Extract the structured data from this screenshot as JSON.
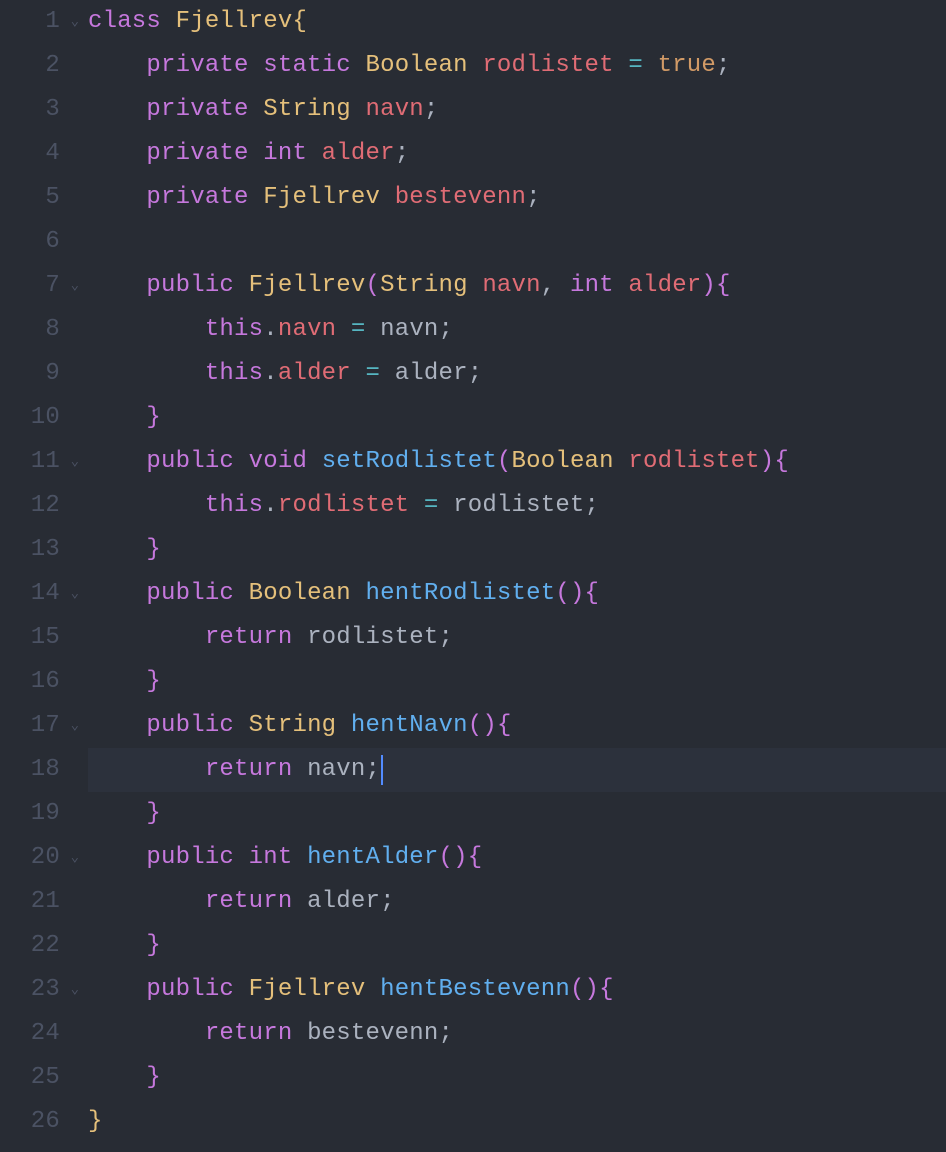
{
  "colors": {
    "background": "#282c34",
    "gutter": "#4b5263",
    "foreground": "#abb2bf",
    "keyword": "#c678dd",
    "type": "#e5c07b",
    "identifier": "#e06c75",
    "function": "#61afef",
    "literal": "#d19a66",
    "operator": "#56b6c2",
    "lineHighlight": "#2c313c",
    "cursor": "#528bff"
  },
  "activeLine": 18,
  "foldLines": [
    1,
    7,
    11,
    14,
    17,
    20,
    23
  ],
  "foldGlyph": "⌄",
  "gutter": {
    "1": "1",
    "2": "2",
    "3": "3",
    "4": "4",
    "5": "5",
    "6": "6",
    "7": "7",
    "8": "8",
    "9": "9",
    "10": "10",
    "11": "11",
    "12": "12",
    "13": "13",
    "14": "14",
    "15": "15",
    "16": "16",
    "17": "17",
    "18": "18",
    "19": "19",
    "20": "20",
    "21": "21",
    "22": "22",
    "23": "23",
    "24": "24",
    "25": "25",
    "26": "26"
  },
  "code": {
    "line1": {
      "kw_class": "class",
      "sp": " ",
      "type": "Fjellrev",
      "brace": "{"
    },
    "line2": {
      "ind": "    ",
      "kw1": "private",
      "sp1": " ",
      "kw2": "static",
      "sp2": " ",
      "type": "Boolean",
      "sp3": " ",
      "name": "rodlistet",
      "sp4": " ",
      "op": "=",
      "sp5": " ",
      "lit": "true",
      "semi": ";"
    },
    "line3": {
      "ind": "    ",
      "kw": "private",
      "sp1": " ",
      "type": "String",
      "sp2": " ",
      "name": "navn",
      "semi": ";"
    },
    "line4": {
      "ind": "    ",
      "kw": "private",
      "sp1": " ",
      "type": "int",
      "sp2": " ",
      "name": "alder",
      "semi": ";"
    },
    "line5": {
      "ind": "    ",
      "kw": "private",
      "sp1": " ",
      "type": "Fjellrev",
      "sp2": " ",
      "name": "bestevenn",
      "semi": ";"
    },
    "line7": {
      "ind": "    ",
      "kw": "public",
      "sp1": " ",
      "type": "Fjellrev",
      "lp": "(",
      "p1t": "String",
      "sp2": " ",
      "p1n": "navn",
      "comma": ",",
      "sp3": " ",
      "p2t": "int",
      "sp4": " ",
      "p2n": "alder",
      "rp": ")",
      "brace": "{"
    },
    "line8": {
      "ind": "        ",
      "this": "this",
      "dot": ".",
      "field": "navn",
      "sp1": " ",
      "op": "=",
      "sp2": " ",
      "val": "navn",
      "semi": ";"
    },
    "line9": {
      "ind": "        ",
      "this": "this",
      "dot": ".",
      "field": "alder",
      "sp1": " ",
      "op": "=",
      "sp2": " ",
      "val": "alder",
      "semi": ";"
    },
    "line10": {
      "ind": "    ",
      "brace": "}"
    },
    "line11": {
      "ind": "    ",
      "kw1": "public",
      "sp1": " ",
      "kw2": "void",
      "sp2": " ",
      "func": "setRodlistet",
      "lp": "(",
      "pt": "Boolean",
      "sp3": " ",
      "pn": "rodlistet",
      "rp": ")",
      "brace": "{"
    },
    "line12": {
      "ind": "        ",
      "this": "this",
      "dot": ".",
      "field": "rodlistet",
      "sp1": " ",
      "op": "=",
      "sp2": " ",
      "val": "rodlistet",
      "semi": ";"
    },
    "line13": {
      "ind": "    ",
      "brace": "}"
    },
    "line14": {
      "ind": "    ",
      "kw": "public",
      "sp1": " ",
      "type": "Boolean",
      "sp2": " ",
      "func": "hentRodlistet",
      "lp": "(",
      "rp": ")",
      "brace": "{"
    },
    "line15": {
      "ind": "        ",
      "kw": "return",
      "sp": " ",
      "val": "rodlistet",
      "semi": ";"
    },
    "line16": {
      "ind": "    ",
      "brace": "}"
    },
    "line17": {
      "ind": "    ",
      "kw": "public",
      "sp1": " ",
      "type": "String",
      "sp2": " ",
      "func": "hentNavn",
      "lp": "(",
      "rp": ")",
      "brace": "{"
    },
    "line18": {
      "ind": "        ",
      "kw": "return",
      "sp": " ",
      "val": "navn",
      "semi": ";"
    },
    "line19": {
      "ind": "    ",
      "brace": "}"
    },
    "line20": {
      "ind": "    ",
      "kw": "public",
      "sp1": " ",
      "type": "int",
      "sp2": " ",
      "func": "hentAlder",
      "lp": "(",
      "rp": ")",
      "brace": "{"
    },
    "line21": {
      "ind": "        ",
      "kw": "return",
      "sp": " ",
      "val": "alder",
      "semi": ";"
    },
    "line22": {
      "ind": "    ",
      "brace": "}"
    },
    "line23": {
      "ind": "    ",
      "kw": "public",
      "sp1": " ",
      "type": "Fjellrev",
      "sp2": " ",
      "func": "hentBestevenn",
      "lp": "(",
      "rp": ")",
      "brace": "{"
    },
    "line24": {
      "ind": "        ",
      "kw": "return",
      "sp": " ",
      "val": "bestevenn",
      "semi": ";"
    },
    "line25": {
      "ind": "    ",
      "brace": "}"
    },
    "line26": {
      "brace": "}"
    }
  }
}
